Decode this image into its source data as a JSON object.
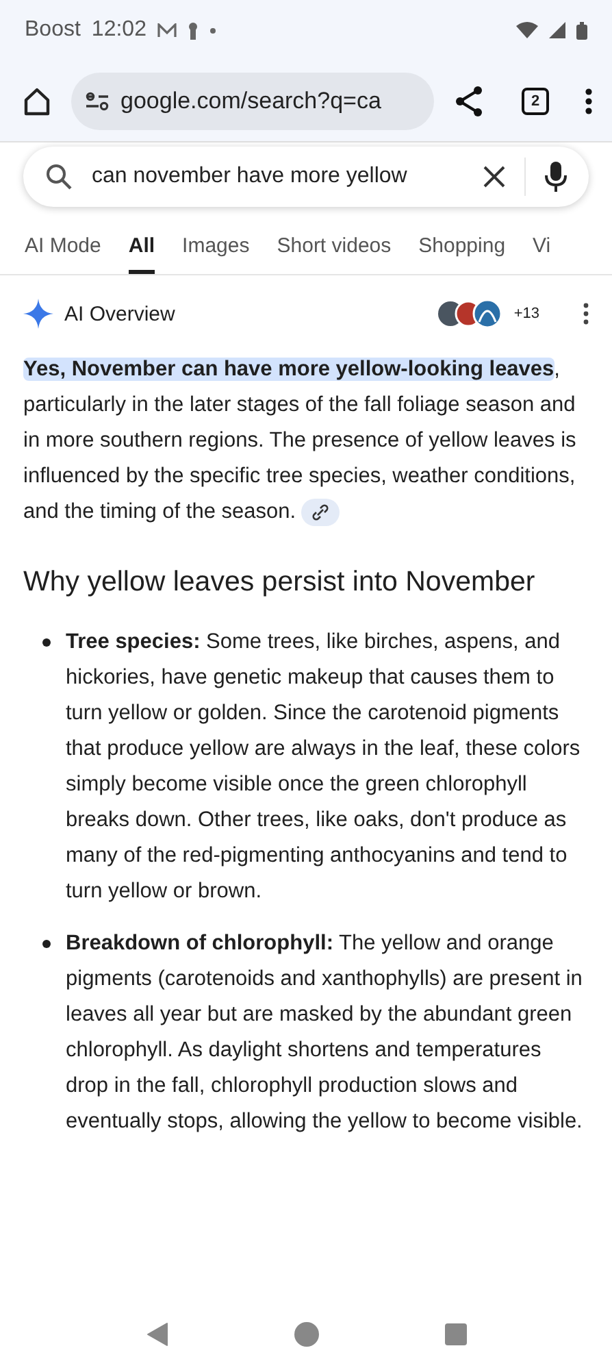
{
  "status_bar": {
    "carrier": "Boost",
    "time": "12:02"
  },
  "toolbar": {
    "url": "google.com/search?q=ca",
    "tab_count": "2"
  },
  "search": {
    "value": "can november have more yellow"
  },
  "tabs": [
    {
      "label": "AI Mode",
      "selected": false
    },
    {
      "label": "All",
      "selected": true
    },
    {
      "label": "Images",
      "selected": false
    },
    {
      "label": "Short videos",
      "selected": false
    },
    {
      "label": "Shopping",
      "selected": false
    },
    {
      "label": "Vi",
      "selected": false
    }
  ],
  "overview": {
    "title": "AI Overview",
    "sources_more": "+13",
    "intro": "**Yes, November can have more yellow-looking leaves**, particularly in the later stages of the fall foliage season and in more southern regions. The presence of yellow leaves is influenced by the specific tree species, weather conditions, and the timing of the season.",
    "heading": "Why yellow leaves persist into November",
    "bullets": [
      "**Tree species:** Some trees, like birches, aspens, and hickories, have genetic makeup that causes them to turn yellow or golden. Since the carotenoid pigments that produce yellow are always in the leaf, these colors simply become visible once the green chlorophyll breaks down. Other trees, like oaks, don't produce as many of the red-pigmenting anthocyanins and tend to turn yellow or brown.",
      "**Breakdown of chlorophyll:** The yellow and orange pigments (carotenoids and xanthophylls) are present in leaves all year but are masked by the abundant green chlorophyll. As daylight shortens and temperatures drop in the fall, chlorophyll production slows and eventually stops, allowing the yellow to become visible."
    ]
  }
}
